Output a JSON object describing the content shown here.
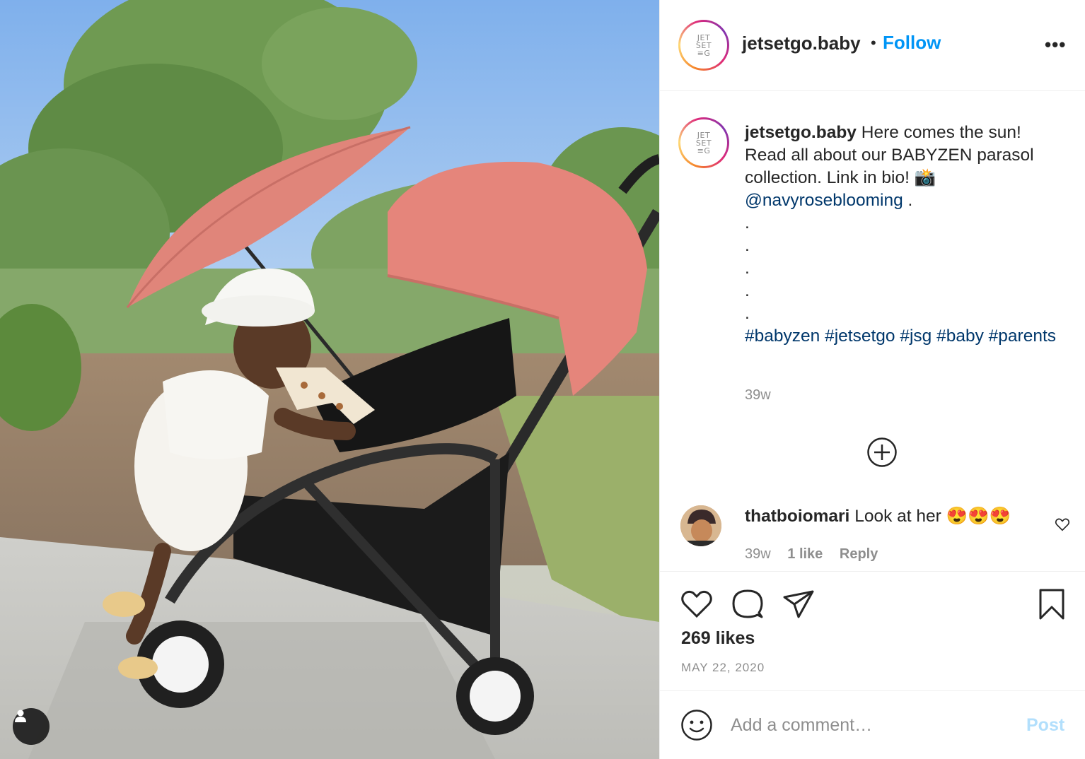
{
  "post": {
    "photo_alt_icon": "user-tag-icon",
    "author": {
      "username": "jetsetgo.baby",
      "avatar_lines": [
        "JET",
        "SET",
        "≡G"
      ],
      "follow_label": "Follow",
      "separator": "•",
      "more_label": "•••"
    },
    "caption": {
      "username": "jetsetgo.baby",
      "text": "Here comes the sun! Read all about our BABYZEN parasol collection. Link in bio! 📸",
      "mention": "@navyroseblooming",
      "mention_suffix": " .",
      "dots": [
        ".",
        ".",
        ".",
        ".",
        "."
      ],
      "hashtags": [
        "#babyzen",
        "#jetsetgo",
        "#jsg",
        "#baby",
        "#parents"
      ],
      "age": "39w"
    },
    "load_more_icon": "plus-circle-icon",
    "comments": [
      {
        "username": "thatboiomari",
        "text": "Look at her 😍😍😍",
        "age": "39w",
        "likes": "1 like",
        "reply_label": "Reply"
      }
    ],
    "likes": "269 likes",
    "date": "MAY 22, 2020",
    "add_comment": {
      "placeholder": "Add a comment…",
      "post_label": "Post"
    },
    "colors": {
      "follow": "#0095f6",
      "link": "#00376b",
      "muted": "#8e8e8e",
      "post_disabled": "#b2dffc",
      "canopy": "#e5857b"
    }
  }
}
